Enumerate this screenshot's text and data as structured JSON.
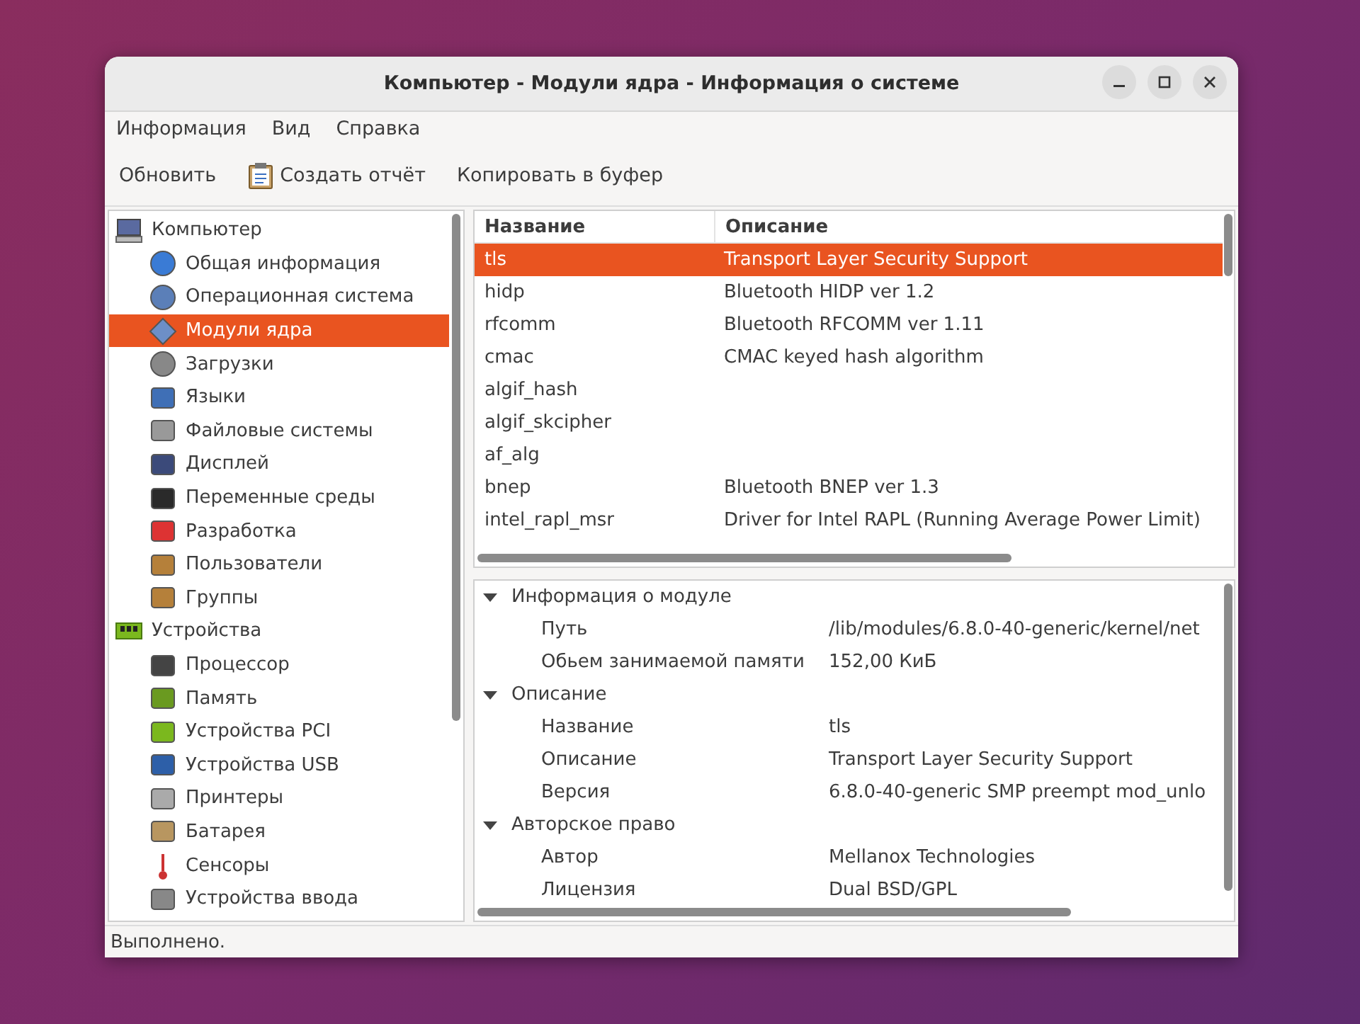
{
  "window": {
    "title": "Компьютер - Модули ядра - Информация о системе"
  },
  "menu": [
    "Информация",
    "Вид",
    "Справка"
  ],
  "toolbar": [
    {
      "label": "Обновить",
      "kind": "plain"
    },
    {
      "label": "Создать отчёт",
      "kind": "report"
    },
    {
      "label": "Копировать в буфер",
      "kind": "plain"
    }
  ],
  "sidebar": {
    "items": [
      {
        "label": "Компьютер",
        "selected": false,
        "children": [
          {
            "label": "Общая информация",
            "selected": false
          },
          {
            "label": "Операционная система",
            "selected": false
          },
          {
            "label": "Модули ядра",
            "selected": true
          },
          {
            "label": "Загрузки",
            "selected": false
          },
          {
            "label": "Языки",
            "selected": false
          },
          {
            "label": "Файловые системы",
            "selected": false
          },
          {
            "label": "Дисплей",
            "selected": false
          },
          {
            "label": "Переменные среды",
            "selected": false
          },
          {
            "label": "Разработка",
            "selected": false
          },
          {
            "label": "Пользователи",
            "selected": false
          },
          {
            "label": "Группы",
            "selected": false
          }
        ]
      },
      {
        "label": "Устройства",
        "selected": false,
        "children": [
          {
            "label": "Процессор",
            "selected": false
          },
          {
            "label": "Память",
            "selected": false
          },
          {
            "label": "Устройства PCI",
            "selected": false
          },
          {
            "label": "Устройства USB",
            "selected": false
          },
          {
            "label": "Принтеры",
            "selected": false
          },
          {
            "label": "Батарея",
            "selected": false
          },
          {
            "label": "Сенсоры",
            "selected": false
          },
          {
            "label": "Устройства ввода",
            "selected": false
          }
        ]
      }
    ]
  },
  "table": {
    "columns": [
      "Название",
      "Описание"
    ],
    "rows": [
      {
        "name": "tls",
        "description": "Transport Layer Security Support",
        "selected": true
      },
      {
        "name": "hidp",
        "description": "Bluetooth HIDP ver 1.2",
        "selected": false
      },
      {
        "name": "rfcomm",
        "description": "Bluetooth RFCOMM ver 1.11",
        "selected": false
      },
      {
        "name": "cmac",
        "description": "CMAC keyed hash algorithm",
        "selected": false
      },
      {
        "name": "algif_hash",
        "description": "",
        "selected": false
      },
      {
        "name": "algif_skcipher",
        "description": "",
        "selected": false
      },
      {
        "name": "af_alg",
        "description": "",
        "selected": false
      },
      {
        "name": "bnep",
        "description": "Bluetooth BNEP ver 1.3",
        "selected": false
      },
      {
        "name": "intel_rapl_msr",
        "description": "Driver for Intel RAPL (Running Average Power Limit)",
        "selected": false
      }
    ]
  },
  "details": [
    {
      "title": "Информация о модуле",
      "expanded": true,
      "fields": [
        {
          "label": "Путь",
          "value": "/lib/modules/6.8.0-40-generic/kernel/net"
        },
        {
          "label": "Обьем занимаемой памяти",
          "value": "152,00 КиБ"
        }
      ]
    },
    {
      "title": "Описание",
      "expanded": true,
      "fields": [
        {
          "label": "Название",
          "value": "tls"
        },
        {
          "label": "Описание",
          "value": "Transport Layer Security Support"
        },
        {
          "label": "Версия",
          "value": "6.8.0-40-generic SMP preempt mod_unlo"
        }
      ]
    },
    {
      "title": "Авторское право",
      "expanded": true,
      "fields": [
        {
          "label": "Автор",
          "value": "Mellanox Technologies"
        },
        {
          "label": "Лицензия",
          "value": "Dual BSD/GPL"
        }
      ]
    }
  ],
  "status_bar": "Выполнено."
}
